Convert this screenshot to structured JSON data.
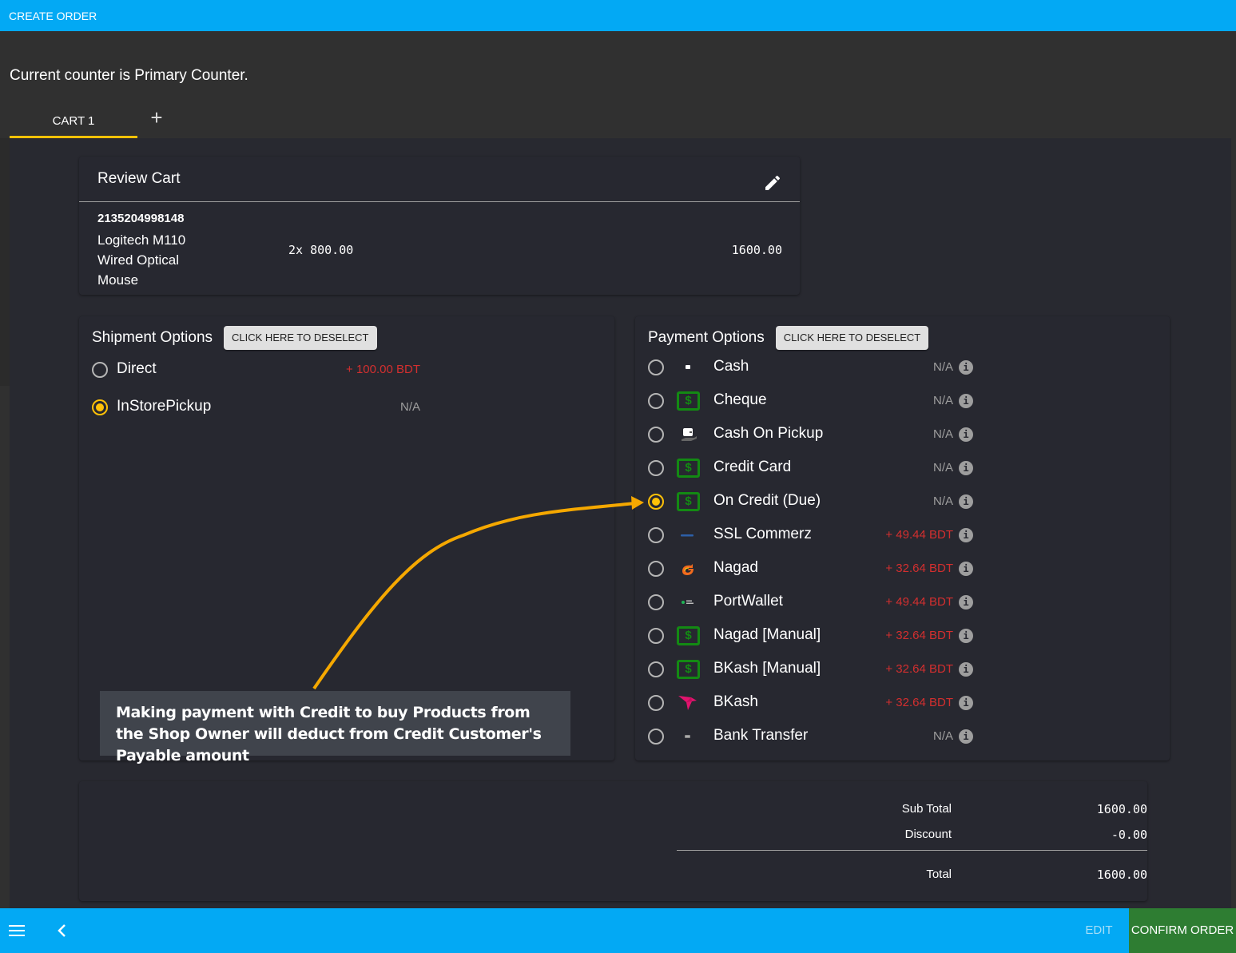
{
  "appbar": {
    "title": "CREATE ORDER"
  },
  "counter_message": "Current counter is Primary Counter.",
  "tabs": [
    {
      "label": "CART 1",
      "active": true
    }
  ],
  "add_tab_label": "+",
  "review_cart": {
    "title": "Review Cart",
    "items": [
      {
        "sku": "2135204998148",
        "name": "Logitech M110 Wired Optical Mouse",
        "quantity_price": "2x 800.00",
        "total": "1600.00"
      }
    ]
  },
  "shipment": {
    "title": "Shipment Options",
    "deselect_label": "CLICK HERE TO DESELECT",
    "options": [
      {
        "label": "Direct",
        "price": "+ 100.00 BDT",
        "selected": false,
        "price_type": "fee"
      },
      {
        "label": "InStorePickup",
        "price": "N/A",
        "selected": true,
        "price_type": "na"
      }
    ]
  },
  "payment": {
    "title": "Payment Options",
    "deselect_label": "CLICK HERE TO DESELECT",
    "info_glyph": "i",
    "options": [
      {
        "label": "Cash",
        "price": "N/A",
        "icon": "cash-icon",
        "selected": false
      },
      {
        "label": "Cheque",
        "price": "N/A",
        "icon": "money-icon",
        "selected": false
      },
      {
        "label": "Cash On Pickup",
        "price": "N/A",
        "icon": "cash-on-pickup-icon",
        "selected": false
      },
      {
        "label": "Credit Card",
        "price": "N/A",
        "icon": "money-icon",
        "selected": false
      },
      {
        "label": "On Credit (Due)",
        "price": "N/A",
        "icon": "money-icon",
        "selected": true
      },
      {
        "label": "SSL Commerz",
        "price": "+ 49.44 BDT",
        "icon": "sslcommerz-logo-icon",
        "selected": false
      },
      {
        "label": "Nagad",
        "price": "+ 32.64 BDT",
        "icon": "nagad-logo-icon",
        "selected": false
      },
      {
        "label": "PortWallet",
        "price": "+ 49.44 BDT",
        "icon": "portwallet-logo-icon",
        "selected": false
      },
      {
        "label": "Nagad [Manual]",
        "price": "+ 32.64 BDT",
        "icon": "money-icon",
        "selected": false
      },
      {
        "label": "BKash [Manual]",
        "price": "+ 32.64 BDT",
        "icon": "money-icon",
        "selected": false
      },
      {
        "label": "BKash",
        "price": "+ 32.64 BDT",
        "icon": "bkash-logo-icon",
        "selected": false
      },
      {
        "label": "Bank Transfer",
        "price": "N/A",
        "icon": "bank-transfer-icon",
        "selected": false
      }
    ]
  },
  "callout": {
    "text": "Making payment with Credit to buy Products from the Shop Owner will deduct from Credit Customer's Payable amount"
  },
  "summary": {
    "rows": [
      {
        "label": "Sub Total",
        "value": "1600.00"
      },
      {
        "label": "Discount",
        "value": "-0.00"
      },
      {
        "label": "Total",
        "value": "1600.00"
      }
    ]
  },
  "bottombar": {
    "edit_label": "EDIT",
    "confirm_label": "CONFIRM ORDER"
  },
  "colors": {
    "primary": "#03a9f4",
    "accent": "#ffc107",
    "confirm": "#2e7d32",
    "fee": "#d32f2f",
    "arrow": "#f5a800"
  }
}
